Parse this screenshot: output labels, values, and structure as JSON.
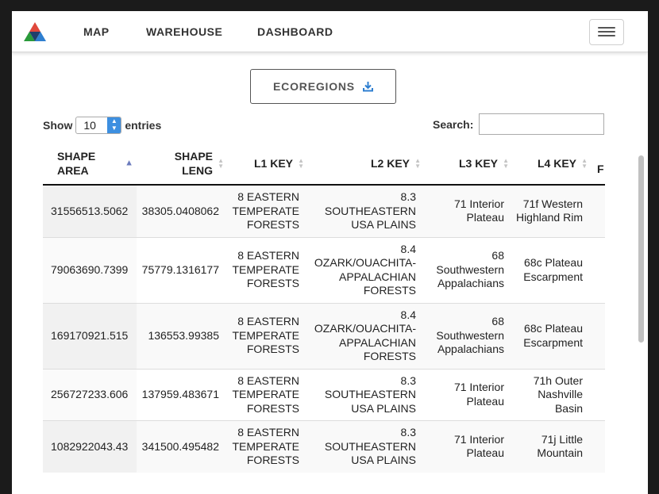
{
  "nav": {
    "links": [
      "MAP",
      "WAREHOUSE",
      "DASHBOARD"
    ],
    "active": "MAP"
  },
  "download_button": {
    "label": "ECOREGIONS"
  },
  "length_control": {
    "show_label": "Show",
    "value": "10",
    "entries_label": "entries"
  },
  "search": {
    "label": "Search:",
    "value": ""
  },
  "table": {
    "columns": [
      "SHAPE AREA",
      "SHAPE LENG",
      "L1 KEY",
      "L2 KEY",
      "L3 KEY",
      "L4 KEY",
      "F"
    ],
    "sorted_column": "SHAPE AREA",
    "sort_direction": "ascending",
    "rows": [
      [
        "31556513.5062",
        "38305.0408062",
        "8 EASTERN TEMPERATE FORESTS",
        "8.3 SOUTHEASTERN USA PLAINS",
        "71 Interior Plateau",
        "71f Western Highland Rim"
      ],
      [
        "79063690.7399",
        "75779.1316177",
        "8 EASTERN TEMPERATE FORESTS",
        "8.4 OZARK/OUACHITA-APPALACHIAN FORESTS",
        "68 Southwestern Appalachians",
        "68c Plateau Escarpment"
      ],
      [
        "169170921.515",
        "136553.99385",
        "8 EASTERN TEMPERATE FORESTS",
        "8.4 OZARK/OUACHITA-APPALACHIAN FORESTS",
        "68 Southwestern Appalachians",
        "68c Plateau Escarpment"
      ],
      [
        "256727233.606",
        "137959.483671",
        "8 EASTERN TEMPERATE FORESTS",
        "8.3 SOUTHEASTERN USA PLAINS",
        "71 Interior Plateau",
        "71h Outer Nashville Basin"
      ],
      [
        "1082922043.43",
        "341500.495482",
        "8 EASTERN TEMPERATE FORESTS",
        "8.3 SOUTHEASTERN USA PLAINS",
        "71 Interior Plateau",
        "71j Little Mountain"
      ]
    ]
  },
  "colors": {
    "active_nav": "#e0483b",
    "download_icon": "#2f7fd0",
    "select_accent": "#3d8fe0"
  }
}
